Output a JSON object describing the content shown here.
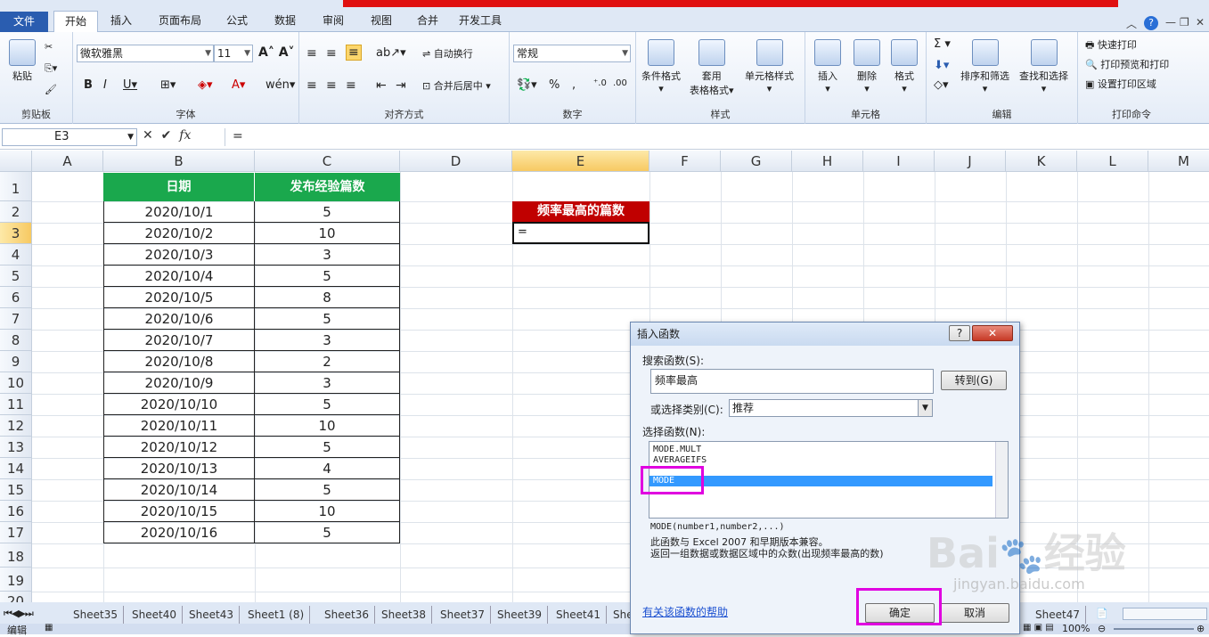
{
  "ribbon_tabs": [
    "文件",
    "开始",
    "插入",
    "页面布局",
    "公式",
    "数据",
    "审阅",
    "视图",
    "合并",
    "开发工具"
  ],
  "ribbon": {
    "paste": "粘贴",
    "font_name": "微软雅黑",
    "font_size": "11",
    "wrap_text": "自动换行",
    "merge_center": "合并后居中",
    "number_format": "常规",
    "cond_format": "条件格式",
    "table_format_1": "套用",
    "table_format_2": "表格格式",
    "cell_style": "单元格样式",
    "insert": "插入",
    "delete": "删除",
    "format": "格式",
    "sort_filter": "排序和筛选",
    "find_select": "查找和选择",
    "quick_print": "快速打印",
    "print_preview": "打印预览和打印",
    "set_print_area": "设置打印区域",
    "groups": [
      "剪贴板",
      "字体",
      "对齐方式",
      "数字",
      "样式",
      "单元格",
      "编辑",
      "打印命令"
    ]
  },
  "formula_bar": {
    "name_box": "E3",
    "formula": "="
  },
  "columns": [
    "A",
    "B",
    "C",
    "D",
    "E",
    "F",
    "G",
    "H",
    "I",
    "J",
    "K",
    "L",
    "M"
  ],
  "rows": [
    "1",
    "2",
    "3",
    "4",
    "5",
    "6",
    "7",
    "8",
    "9",
    "10",
    "11",
    "12",
    "13",
    "14",
    "15",
    "16",
    "17",
    "18",
    "19",
    "20"
  ],
  "table": {
    "headers": [
      "日期",
      "发布经验篇数"
    ],
    "rows": [
      [
        "2020/10/1",
        "5"
      ],
      [
        "2020/10/2",
        "10"
      ],
      [
        "2020/10/3",
        "3"
      ],
      [
        "2020/10/4",
        "5"
      ],
      [
        "2020/10/5",
        "8"
      ],
      [
        "2020/10/6",
        "5"
      ],
      [
        "2020/10/7",
        "3"
      ],
      [
        "2020/10/8",
        "2"
      ],
      [
        "2020/10/9",
        "3"
      ],
      [
        "2020/10/10",
        "5"
      ],
      [
        "2020/10/11",
        "10"
      ],
      [
        "2020/10/12",
        "5"
      ],
      [
        "2020/10/13",
        "4"
      ],
      [
        "2020/10/14",
        "5"
      ],
      [
        "2020/10/15",
        "10"
      ],
      [
        "2020/10/16",
        "5"
      ]
    ]
  },
  "e2_label": "频率最高的篇数",
  "e3_value": "=",
  "sheet_tabs": [
    "Sheet35",
    "Sheet40",
    "Sheet43",
    "Sheet1 (8)",
    "Sheet36",
    "Sheet38",
    "Sheet37",
    "Sheet39",
    "Sheet41",
    "She",
    "Sheet47"
  ],
  "status": {
    "mode": "编辑",
    "zoom": "100%"
  },
  "dialog": {
    "title": "插入函数",
    "search_label": "搜索函数(S):",
    "search_value": "频率最高",
    "go_button": "转到(G)",
    "category_label": "或选择类别(C):",
    "category_value": "推荐",
    "select_label": "选择函数(N):",
    "functions": [
      "MODE.MULT",
      "AVERAGEIFS",
      "MODE"
    ],
    "signature": "MODE(number1,number2,...)",
    "desc1": "此函数与 Excel 2007 和早期版本兼容。",
    "desc2": "返回一组数据或数据区域中的众数(出现频率最高的数)",
    "help_link": "有关该函数的帮助",
    "ok": "确定",
    "cancel": "取消"
  },
  "watermark": {
    "brand": "Bai",
    "cn": "经验",
    "url": "jingyan.baidu.com"
  }
}
